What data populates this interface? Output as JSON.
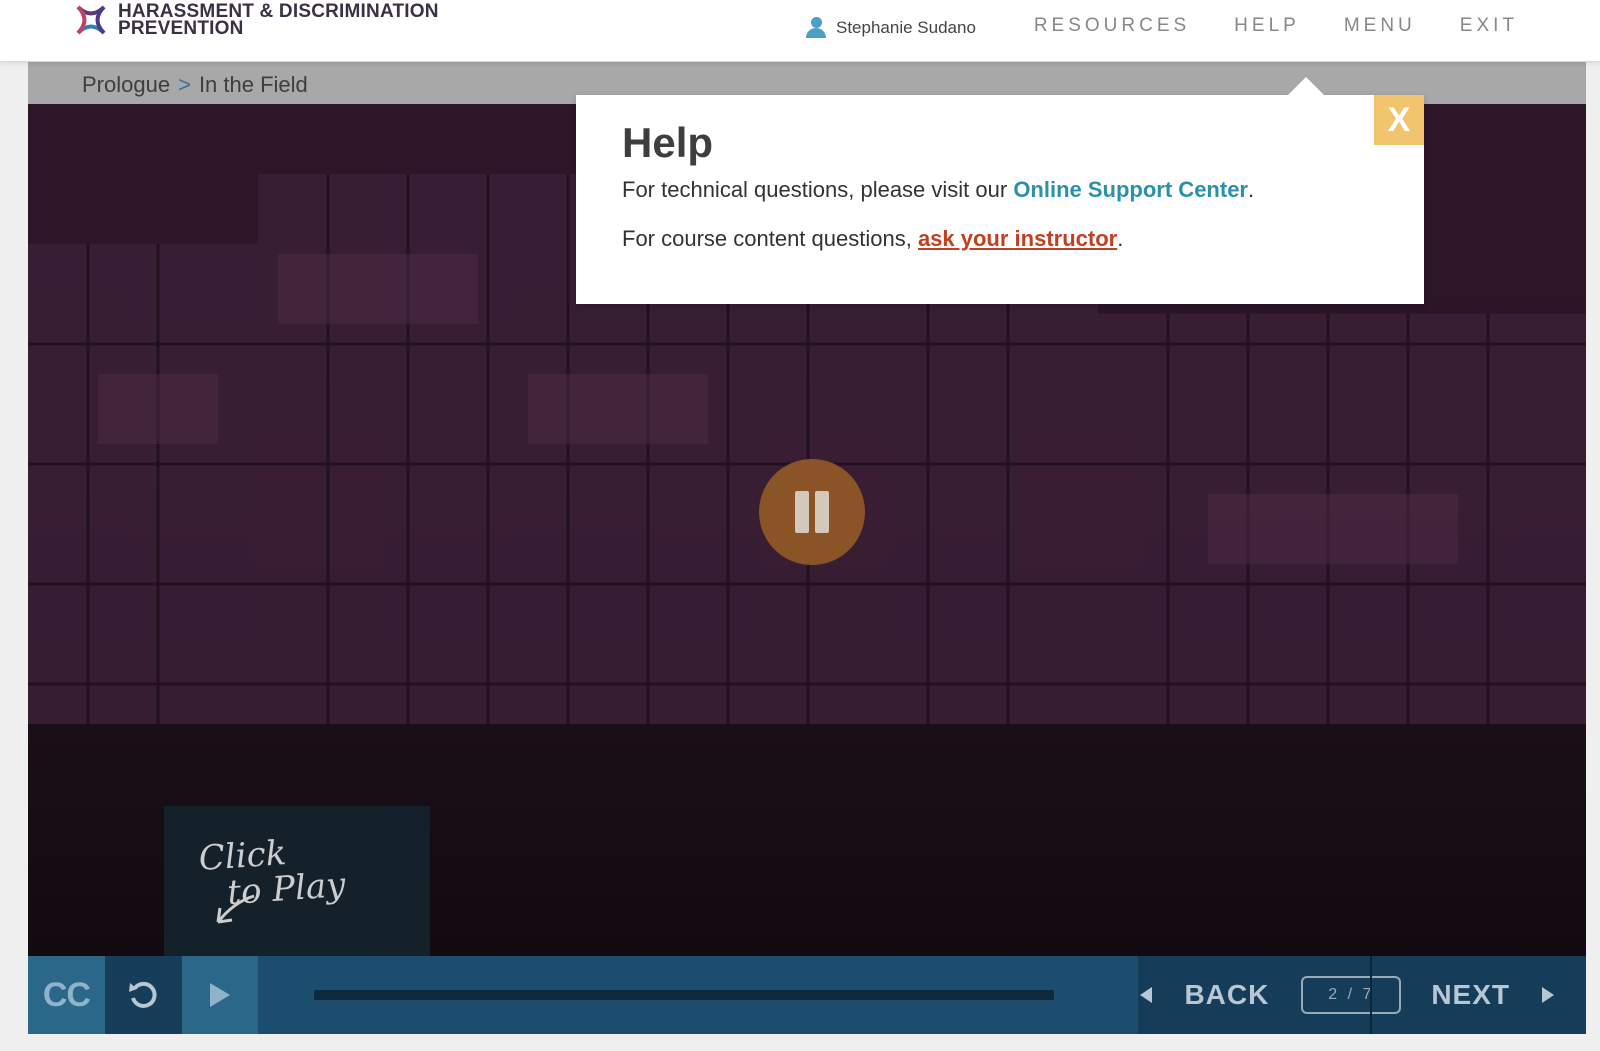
{
  "header": {
    "logo_line1": "HARASSMENT & DISCRIMINATION",
    "logo_line2": "PREVENTION",
    "user_name": "Stephanie Sudano",
    "nav": [
      "RESOURCES",
      "HELP",
      "MENU",
      "EXIT"
    ]
  },
  "breadcrumb": {
    "parent": "Prologue",
    "separator": ">",
    "current": "In the Field"
  },
  "video": {
    "state_icon": "pause-icon",
    "play_card_line1": "Click",
    "play_card_line2": "to Play",
    "progress": 0.0
  },
  "controls": {
    "cc_label": "CC",
    "back_label": "BACK",
    "next_label": "NEXT",
    "counter": "2 / 7"
  },
  "help": {
    "title": "Help",
    "close_label": "X",
    "line1_prefix": "For technical questions, please visit our ",
    "line1_link": "Online Support Center",
    "line1_suffix": ".",
    "line2_prefix": "For course content questions, ",
    "line2_link": "ask your instructor",
    "line2_suffix": "."
  },
  "colors": {
    "accent_blue": "#2b8fae",
    "link_red": "#c2401f",
    "close_yellow": "#f2c46d",
    "control_bar": "#1c4d6e",
    "pause_button": "#8a5427"
  }
}
